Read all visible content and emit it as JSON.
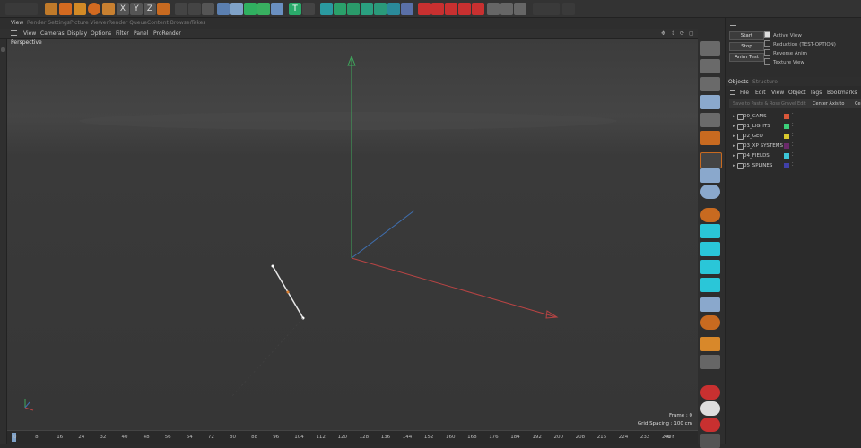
{
  "tabs": [
    "View",
    "Render Settings",
    "Picture Viewer",
    "Render Queue",
    "Content Browser",
    "Takes"
  ],
  "viewport_menu": [
    "View",
    "Cameras",
    "Display",
    "Options",
    "Filter",
    "Panel",
    "ProRender"
  ],
  "viewport": {
    "camera_label": "Perspective",
    "frame_label": "Frame : 0",
    "grid_spacing": "Grid Spacing : 100 cm"
  },
  "attributes": {
    "buttons": [
      "Start",
      "Stop",
      "Anim Test"
    ],
    "options": [
      "Active View",
      "Reduction (TEST-OPTION)",
      "Reverse Anim",
      "Texture View"
    ],
    "checked": [
      true,
      false,
      false,
      false
    ]
  },
  "objects": {
    "tabs": [
      "Objects",
      "Structure"
    ],
    "menu": [
      "File",
      "Edit",
      "View",
      "Object",
      "Tags",
      "Bookmarks"
    ],
    "subtoolbar": [
      "Save to Paste & Rose",
      "Gravel Edit",
      "Center Axis to",
      "Ce"
    ],
    "items": [
      {
        "name": "00_CAMS",
        "color": "#d9573a"
      },
      {
        "name": "01_LIGHTS",
        "color": "#3cd07a"
      },
      {
        "name": "02_GEO",
        "color": "#d8c92e"
      },
      {
        "name": "03_XP SYSTEMS",
        "color": "#6a2a6a"
      },
      {
        "name": "04_FIELDS",
        "color": "#3cc6d8"
      },
      {
        "name": "05_SPLINES",
        "color": "#4040a8"
      }
    ]
  },
  "timeline": {
    "ticks": [
      "0",
      "8",
      "16",
      "24",
      "32",
      "40",
      "48",
      "56",
      "64",
      "72",
      "80",
      "88",
      "96",
      "104",
      "112",
      "120",
      "128",
      "136",
      "144",
      "152",
      "160",
      "168",
      "176",
      "184",
      "192",
      "200",
      "208",
      "216",
      "224",
      "232",
      "240"
    ],
    "current_frame": "0 F"
  },
  "colors": {
    "axis_y": "#3fa85c",
    "axis_x": "#b84444",
    "axis_z": "#3f6fb0",
    "accent": "#7fa2c8"
  }
}
